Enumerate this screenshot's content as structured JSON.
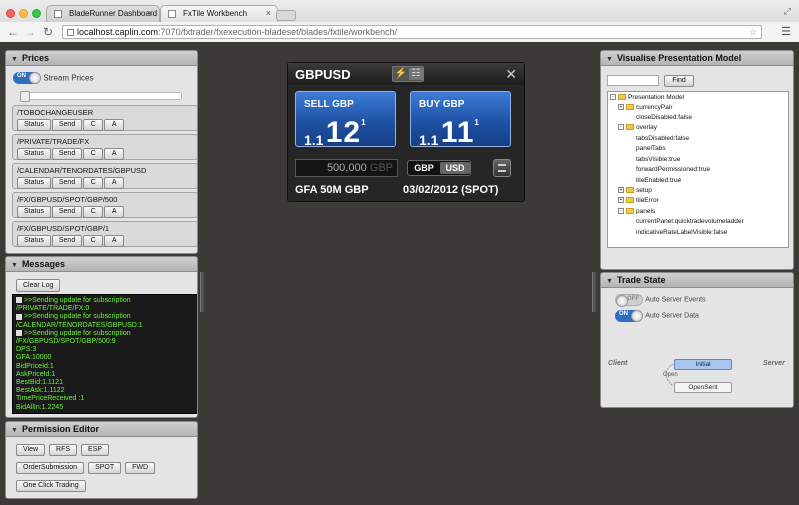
{
  "browser": {
    "tabs": [
      {
        "label": "BladeRunner Dashboard"
      },
      {
        "label": "FxTile Workbench"
      }
    ],
    "url_host": "localhost.caplin.com",
    "url_path": ":7070/fxtrader/fxexecution-bladeset/blades/fxtile/workbench/"
  },
  "prices_panel": {
    "title": "Prices",
    "stream_toggle": "ON",
    "stream_label": "Stream Prices",
    "subjects": [
      {
        "path": "/TOBOCHANGEUSER"
      },
      {
        "path": "/PRIVATE/TRADE/FX"
      },
      {
        "path": "/CALENDAR/TENORDATES/GBPUSD"
      },
      {
        "path": "/FX/GBPUSD/SPOT/GBP/500"
      },
      {
        "path": "/FX/GBPUSD/SPOT/GBP/1"
      }
    ],
    "status_label": "Status",
    "send_label": "Send",
    "c_label": "C",
    "a_label": "A"
  },
  "messages_panel": {
    "title": "Messages",
    "clear_label": "Clear Log",
    "log": [
      {
        "text": ">>Sending update for subscription",
        "marker": true
      },
      {
        "text": "/PRIVATE/TRADE/FX:0",
        "marker": false
      },
      {
        "text": ">>Sending update for subscription",
        "marker": true
      },
      {
        "text": "/CALENDAR/TENORDATES/GBPUSD:1",
        "marker": false
      },
      {
        "text": ">>Sending update for subscription",
        "marker": true
      },
      {
        "text": "/FX/GBPUSD/SPOT/GBP/500:9",
        "marker": false
      },
      {
        "text": "DPS:3",
        "marker": false
      },
      {
        "text": "GFA:10000",
        "marker": false
      },
      {
        "text": "BidPriceId:1",
        "marker": false
      },
      {
        "text": "AskPriceId:1",
        "marker": false
      },
      {
        "text": "BestBid:1.1121",
        "marker": false
      },
      {
        "text": "BestAsk:1.1122",
        "marker": false
      },
      {
        "text": "TimePriceReceived :1",
        "marker": false
      },
      {
        "text": "BidAllIn:1.2245",
        "marker": false
      }
    ]
  },
  "permission_panel": {
    "title": "Permission Editor",
    "row1": [
      "View",
      "RFS",
      "ESP"
    ],
    "row2": [
      "OrderSubmission",
      "SPOT",
      "FWD"
    ],
    "row3": [
      "One Click Trading"
    ]
  },
  "tile": {
    "pair": "GBPUSD",
    "sell_label": "SELL GBP",
    "sell_small": "1.1",
    "sell_big": "12",
    "sell_sup": "1",
    "buy_label": "BUY  GBP",
    "buy_small": "1.1",
    "buy_big": "11",
    "buy_sup": "1",
    "amount": "500,000",
    "amount_ccy": "GBP",
    "ccy_left": "GBP",
    "ccy_right": "USD",
    "gfa": "GFA 50M GBP",
    "settlement": "03/02/2012 (SPOT)",
    "close_glyph": "✕",
    "tab_icons": [
      "⚡",
      "☷"
    ]
  },
  "visualise_panel": {
    "title": "Visualise Presentation Model",
    "find_label": "Find",
    "tree": [
      {
        "label": "Presentation Model",
        "kind": "root"
      },
      {
        "label": "currencyPair",
        "kind": "folder"
      },
      {
        "label": "closeDisabled:false",
        "kind": "leaf"
      },
      {
        "label": "overlay",
        "kind": "folder"
      },
      {
        "label": "tabsDisabled:false",
        "kind": "leaf"
      },
      {
        "label": "panelTabs",
        "kind": "leaf"
      },
      {
        "label": "tabsVisible:true",
        "kind": "leaf"
      },
      {
        "label": "forwardPermissioned:true",
        "kind": "leaf"
      },
      {
        "label": "tileEnabled:true",
        "kind": "leaf"
      },
      {
        "label": "setup",
        "kind": "folder"
      },
      {
        "label": "tileError",
        "kind": "folder"
      },
      {
        "label": "panels",
        "kind": "folder"
      },
      {
        "label": "currentPanel:quicktradevolumeladder",
        "kind": "leaf"
      },
      {
        "label": "indicativeRateLabelVisible:false",
        "kind": "leaf"
      }
    ]
  },
  "trade_state_panel": {
    "title": "Trade State",
    "events_toggle": "OFF",
    "events_label": "Auto Server Events",
    "data_toggle": "ON",
    "data_label": "Auto Server Data",
    "client_label": "Client",
    "server_label": "Server",
    "state_initial": "Initial",
    "transition_label": "Open",
    "state_opensent": "OpenSent"
  }
}
